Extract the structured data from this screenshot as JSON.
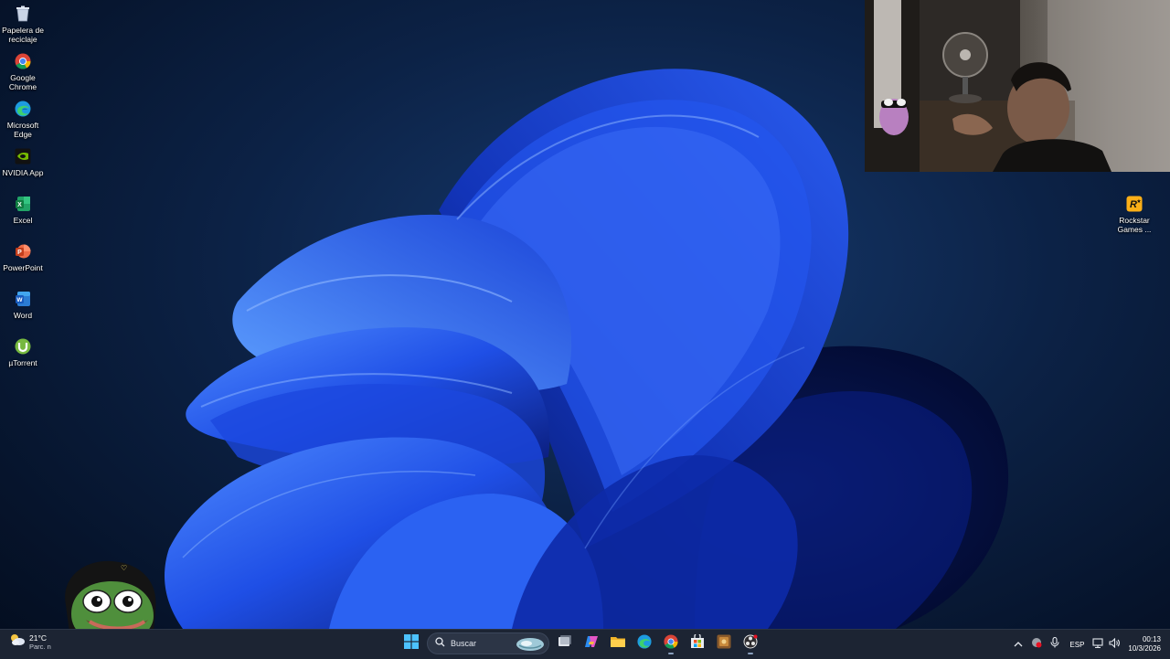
{
  "desktop": {
    "left_icons": [
      {
        "label": "Papelera de reciclaje",
        "icon": "recycle-bin-icon"
      },
      {
        "label": "Google Chrome",
        "icon": "chrome-icon"
      },
      {
        "label": "Microsoft Edge",
        "icon": "edge-icon"
      },
      {
        "label": "NVIDIA App",
        "icon": "nvidia-icon"
      },
      {
        "label": "Excel",
        "icon": "excel-icon"
      },
      {
        "label": "PowerPoint",
        "icon": "powerpoint-icon"
      },
      {
        "label": "Word",
        "icon": "word-icon"
      },
      {
        "label": "µTorrent",
        "icon": "utorrent-icon"
      }
    ],
    "right_icons": [
      {
        "label": "Rockstar Games ...",
        "icon": "rockstar-games-icon"
      }
    ]
  },
  "taskbar": {
    "weather": {
      "temp": "21°C",
      "condition": "Parc. n"
    },
    "search": {
      "placeholder": "Buscar"
    },
    "apps": [
      "start-icon",
      "search-icon",
      "task-view-icon",
      "copilot-icon",
      "file-explorer-icon",
      "edge-icon",
      "chrome-icon",
      "microsoft-store-icon",
      "game-icon",
      "obs-icon"
    ],
    "tray": {
      "language": "ESP",
      "time": "00:13",
      "date": "10/3/2026"
    }
  },
  "colors": {
    "taskbar_bg": "#1c2433",
    "wallpaper_primary": "#1d4de0",
    "wallpaper_bg": "#0c2246"
  }
}
